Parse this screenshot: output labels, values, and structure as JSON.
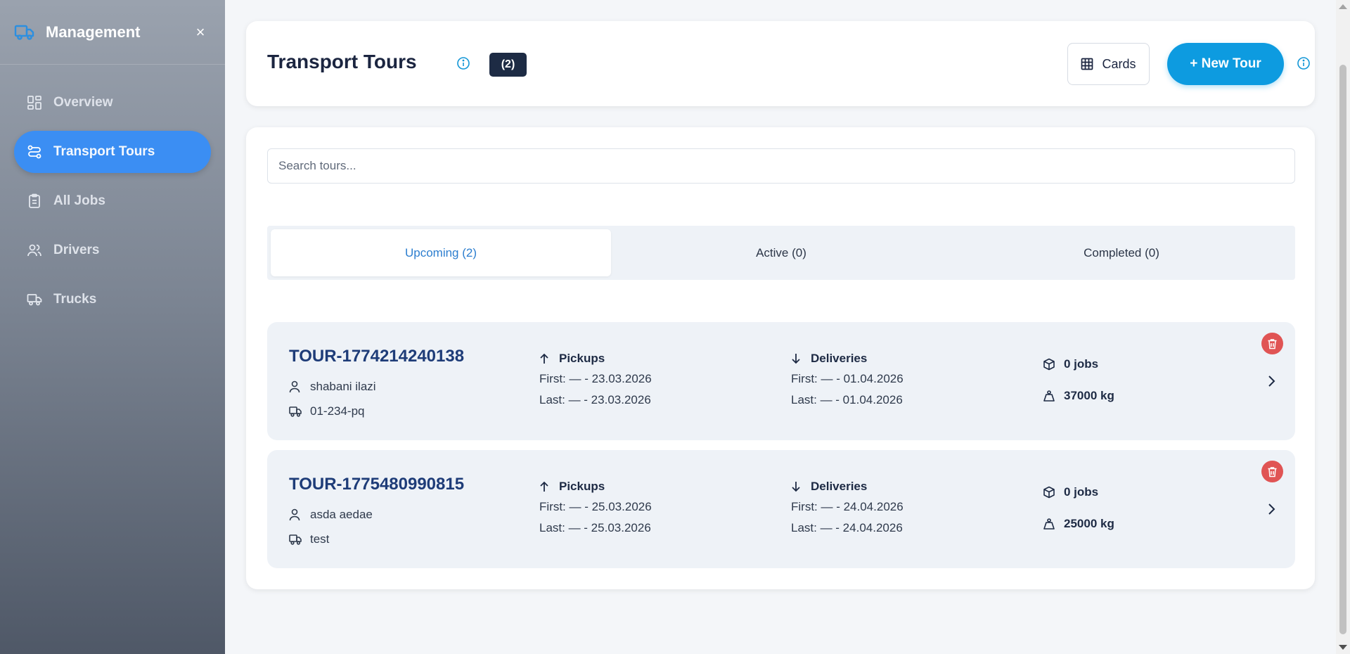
{
  "sidebar": {
    "title": "Management",
    "close": "×",
    "items": [
      {
        "label": "Overview",
        "icon": "grid-icon"
      },
      {
        "label": "Transport Tours",
        "icon": "route-icon",
        "active": true
      },
      {
        "label": "All Jobs",
        "icon": "clipboard-icon"
      },
      {
        "label": "Drivers",
        "icon": "users-icon"
      },
      {
        "label": "Trucks",
        "icon": "truck-icon"
      }
    ]
  },
  "header": {
    "title": "Transport Tours",
    "count": "(2)",
    "cards_label": "Cards",
    "new_tour_label": "+ New Tour"
  },
  "search": {
    "placeholder": "Search tours...",
    "value": ""
  },
  "tabs": [
    {
      "label": "Upcoming (2)",
      "active": true
    },
    {
      "label": "Active (0)"
    },
    {
      "label": "Completed (0)"
    }
  ],
  "tours": [
    {
      "id": "TOUR-1774214240138",
      "driver": "shabani ilazi",
      "truck": "01-234-pq",
      "pickups_label": "Pickups",
      "pickup_first": "First: — - 23.03.2026",
      "pickup_last": "Last: — - 23.03.2026",
      "deliveries_label": "Deliveries",
      "delivery_first": "First: — - 01.04.2026",
      "delivery_last": "Last: — - 01.04.2026",
      "jobs": "0 jobs",
      "weight": "37000 kg"
    },
    {
      "id": "TOUR-1775480990815",
      "driver": "asda aedae",
      "truck": "test",
      "pickups_label": "Pickups",
      "pickup_first": "First: — - 25.03.2026",
      "pickup_last": "Last: — - 25.03.2026",
      "deliveries_label": "Deliveries",
      "delivery_first": "First: — - 24.04.2026",
      "delivery_last": "Last: — - 24.04.2026",
      "jobs": "0 jobs",
      "weight": "25000 kg"
    }
  ],
  "colors": {
    "accent": "#3b8ef3",
    "primary_button": "#0d9be0",
    "delete": "#e05454",
    "tour_id": "#1e3c78"
  }
}
